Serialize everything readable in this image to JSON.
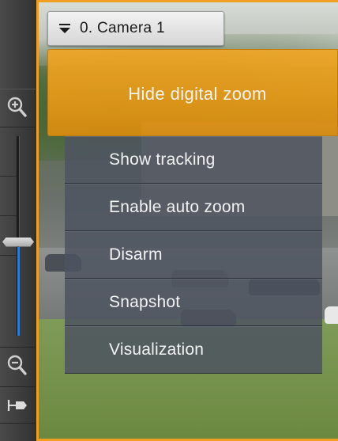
{
  "camera_selector": {
    "label": "0. Camera 1",
    "icon": "dropdown-triangle-icon"
  },
  "menu": {
    "header_item": "Hide digital zoom",
    "items": [
      {
        "label": "Show tracking"
      },
      {
        "label": "Enable auto zoom"
      },
      {
        "label": "Disarm"
      },
      {
        "label": "Snapshot"
      },
      {
        "label": "Visualization"
      }
    ]
  },
  "zoom_toolbar": {
    "zoom_in_icon": "zoom-in-icon",
    "zoom_out_icon": "zoom-out-icon",
    "fit_icon": "fit-to-window-icon",
    "zoom_level_fraction": 0.47
  },
  "colors": {
    "accent_orange": "#f0a726",
    "frame_orange": "#f0a020",
    "menu_bg": "#4e5460",
    "zoom_fill_blue": "#2a7fd4"
  }
}
